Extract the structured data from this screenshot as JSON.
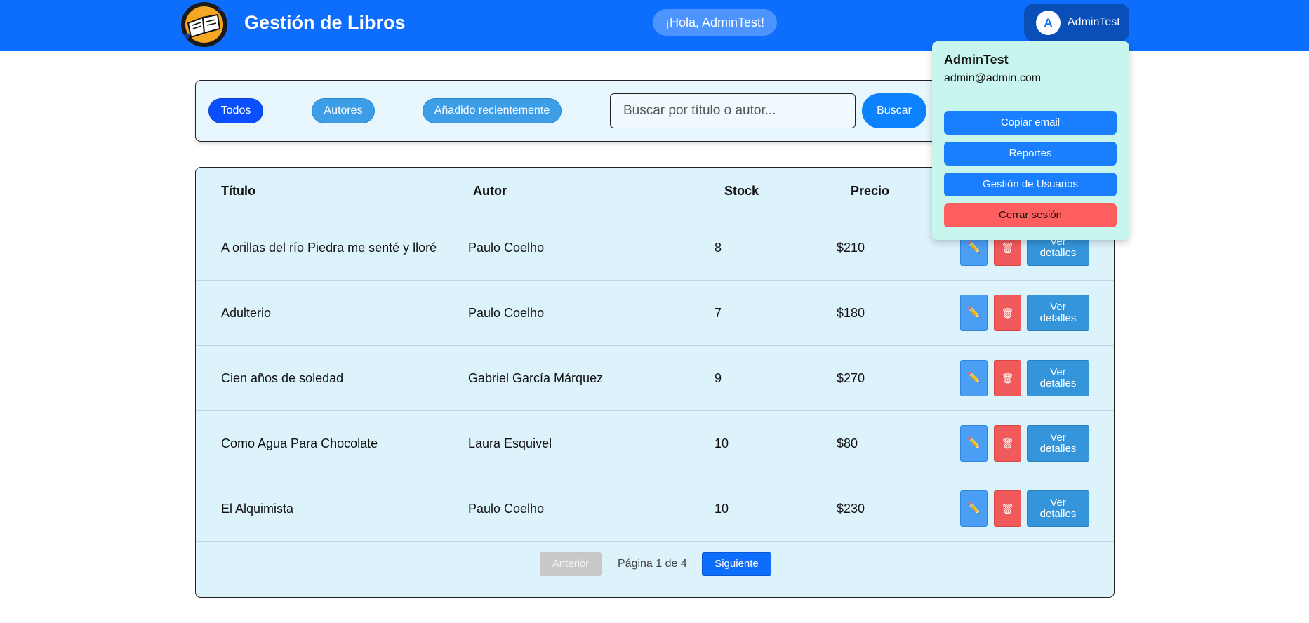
{
  "header": {
    "title": "Gestión de Libros",
    "greeting": "¡Hola, AdminTest!",
    "avatar_letter": "A",
    "user_name": "AdminTest",
    "logo_icon": "open-book-logo-icon"
  },
  "filters": {
    "todos": "Todos",
    "autores": "Autores",
    "recientes": "Añadido recientemente",
    "search_placeholder": "Buscar por título o autor...",
    "search_button": "Buscar"
  },
  "table": {
    "headers": [
      "Título",
      "Autor",
      "Stock",
      "Precio"
    ],
    "rows": [
      {
        "titulo": "A orillas del río Piedra me senté y lloré",
        "autor": "Paulo Coelho",
        "stock": "8",
        "precio": "$210"
      },
      {
        "titulo": "Adulterio",
        "autor": "Paulo Coelho",
        "stock": "7",
        "precio": "$180"
      },
      {
        "titulo": "Cien años de soledad",
        "autor": "Gabriel García Márquez",
        "stock": "9",
        "precio": "$270"
      },
      {
        "titulo": "Como Agua Para Chocolate",
        "autor": "Laura Esquivel",
        "stock": "10",
        "precio": "$80"
      },
      {
        "titulo": "El Alquimista",
        "autor": "Paulo Coelho",
        "stock": "10",
        "precio": "$230"
      }
    ],
    "edit_icon": "✏️",
    "delete_icon": "🗑",
    "view_label_line1": "Ver",
    "view_label_line2": "detalles"
  },
  "pagination": {
    "prev": "Anterior",
    "info": "Página 1 de 4",
    "next": "Siguiente"
  },
  "dropdown": {
    "name": "AdminTest",
    "email": "admin@admin.com",
    "copy_email": "Copiar email",
    "reports": "Reportes",
    "users": "Gestión de Usuarios",
    "logout": "Cerrar sesión"
  },
  "colors": {
    "primary": "#0d6efd",
    "danger": "#ff5e5e",
    "table_bg": "#dcf3fc",
    "dropdown_bg": "#c8f6ee"
  }
}
